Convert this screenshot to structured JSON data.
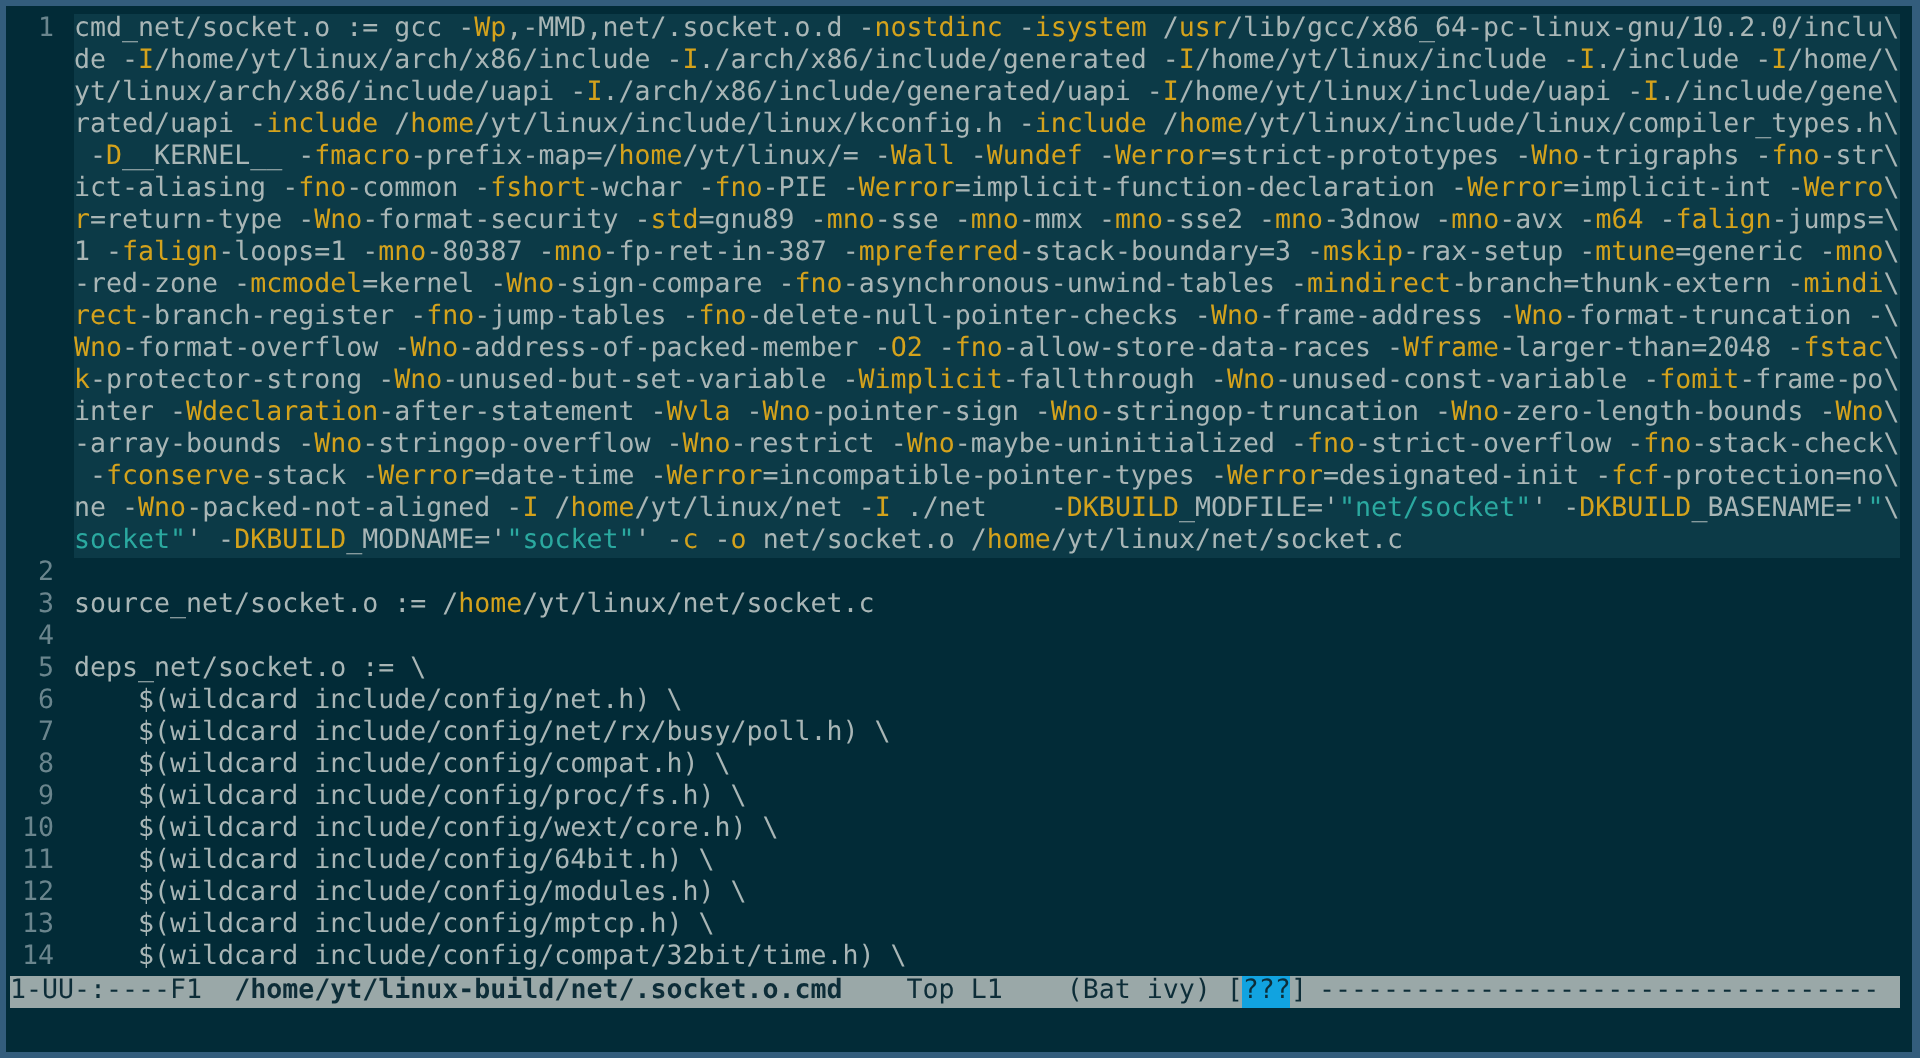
{
  "editor": {
    "lines": [
      {
        "number": "1",
        "highlighted": true,
        "wrapped": [
          {
            "spans": [
              {
                "kind": "plain",
                "text": "cmd_net/socket.o := gcc -"
              },
              {
                "kind": "option",
                "text": "Wp"
              },
              {
                "kind": "plain",
                "text": ",-MMD,net/.socket.o.d -"
              },
              {
                "kind": "option",
                "text": "nostdinc"
              },
              {
                "kind": "plain",
                "text": " -"
              },
              {
                "kind": "option",
                "text": "isystem"
              },
              {
                "kind": "plain",
                "text": " /"
              },
              {
                "kind": "option",
                "text": "usr"
              },
              {
                "kind": "plain",
                "text": "/lib/gcc/x86_64-pc-linux-gnu/10.2.0/inclu\\"
              }
            ]
          },
          {
            "spans": [
              {
                "kind": "plain",
                "text": "de -"
              },
              {
                "kind": "option",
                "text": "I"
              },
              {
                "kind": "plain",
                "text": "/home/yt/linux/arch/x86/include -"
              },
              {
                "kind": "option",
                "text": "I"
              },
              {
                "kind": "plain",
                "text": "./arch/x86/include/generated -"
              },
              {
                "kind": "option",
                "text": "I"
              },
              {
                "kind": "plain",
                "text": "/home/yt/linux/include -"
              },
              {
                "kind": "option",
                "text": "I"
              },
              {
                "kind": "plain",
                "text": "./include -"
              },
              {
                "kind": "option",
                "text": "I"
              },
              {
                "kind": "plain",
                "text": "/home/\\"
              }
            ]
          },
          {
            "spans": [
              {
                "kind": "plain",
                "text": "yt/linux/arch/x86/include/uapi -"
              },
              {
                "kind": "option",
                "text": "I"
              },
              {
                "kind": "plain",
                "text": "./arch/x86/include/generated/uapi -"
              },
              {
                "kind": "option",
                "text": "I"
              },
              {
                "kind": "plain",
                "text": "/home/yt/linux/include/uapi -"
              },
              {
                "kind": "option",
                "text": "I"
              },
              {
                "kind": "plain",
                "text": "./include/gene\\"
              }
            ]
          },
          {
            "spans": [
              {
                "kind": "plain",
                "text": "rated/uapi -"
              },
              {
                "kind": "option",
                "text": "include"
              },
              {
                "kind": "plain",
                "text": " /"
              },
              {
                "kind": "option",
                "text": "home"
              },
              {
                "kind": "plain",
                "text": "/yt/linux/include/linux/kconfig.h -"
              },
              {
                "kind": "option",
                "text": "include"
              },
              {
                "kind": "plain",
                "text": " /"
              },
              {
                "kind": "option",
                "text": "home"
              },
              {
                "kind": "plain",
                "text": "/yt/linux/include/linux/compiler_types.h\\"
              }
            ]
          },
          {
            "spans": [
              {
                "kind": "plain",
                "text": " -"
              },
              {
                "kind": "option",
                "text": "D"
              },
              {
                "kind": "plain",
                "text": "__KERNEL__ -"
              },
              {
                "kind": "option",
                "text": "fmacro"
              },
              {
                "kind": "plain",
                "text": "-prefix-map=/"
              },
              {
                "kind": "option",
                "text": "home"
              },
              {
                "kind": "plain",
                "text": "/yt/linux/= -"
              },
              {
                "kind": "option",
                "text": "Wall"
              },
              {
                "kind": "plain",
                "text": " -"
              },
              {
                "kind": "option",
                "text": "Wundef"
              },
              {
                "kind": "plain",
                "text": " -"
              },
              {
                "kind": "option",
                "text": "Werror"
              },
              {
                "kind": "plain",
                "text": "=strict-prototypes -"
              },
              {
                "kind": "option",
                "text": "Wno"
              },
              {
                "kind": "plain",
                "text": "-trigraphs -"
              },
              {
                "kind": "option",
                "text": "fno"
              },
              {
                "kind": "plain",
                "text": "-str\\"
              }
            ]
          },
          {
            "spans": [
              {
                "kind": "plain",
                "text": "ict-aliasing -"
              },
              {
                "kind": "option",
                "text": "fno"
              },
              {
                "kind": "plain",
                "text": "-common -"
              },
              {
                "kind": "option",
                "text": "fshort"
              },
              {
                "kind": "plain",
                "text": "-wchar -"
              },
              {
                "kind": "option",
                "text": "fno"
              },
              {
                "kind": "plain",
                "text": "-PIE -"
              },
              {
                "kind": "option",
                "text": "Werror"
              },
              {
                "kind": "plain",
                "text": "=implicit-function-declaration -"
              },
              {
                "kind": "option",
                "text": "Werror"
              },
              {
                "kind": "plain",
                "text": "=implicit-int -"
              },
              {
                "kind": "option",
                "text": "Werro"
              },
              {
                "kind": "plain",
                "text": "\\"
              }
            ]
          },
          {
            "spans": [
              {
                "kind": "option",
                "text": "r"
              },
              {
                "kind": "plain",
                "text": "=return-type -"
              },
              {
                "kind": "option",
                "text": "Wno"
              },
              {
                "kind": "plain",
                "text": "-format-security -"
              },
              {
                "kind": "option",
                "text": "std"
              },
              {
                "kind": "plain",
                "text": "=gnu89 -"
              },
              {
                "kind": "option",
                "text": "mno"
              },
              {
                "kind": "plain",
                "text": "-sse -"
              },
              {
                "kind": "option",
                "text": "mno"
              },
              {
                "kind": "plain",
                "text": "-mmx -"
              },
              {
                "kind": "option",
                "text": "mno"
              },
              {
                "kind": "plain",
                "text": "-sse2 -"
              },
              {
                "kind": "option",
                "text": "mno"
              },
              {
                "kind": "plain",
                "text": "-3dnow -"
              },
              {
                "kind": "option",
                "text": "mno"
              },
              {
                "kind": "plain",
                "text": "-avx -"
              },
              {
                "kind": "option",
                "text": "m64"
              },
              {
                "kind": "plain",
                "text": " -"
              },
              {
                "kind": "option",
                "text": "falign"
              },
              {
                "kind": "plain",
                "text": "-jumps=\\"
              }
            ]
          },
          {
            "spans": [
              {
                "kind": "plain",
                "text": "1 -"
              },
              {
                "kind": "option",
                "text": "falign"
              },
              {
                "kind": "plain",
                "text": "-loops=1 -"
              },
              {
                "kind": "option",
                "text": "mno"
              },
              {
                "kind": "plain",
                "text": "-80387 -"
              },
              {
                "kind": "option",
                "text": "mno"
              },
              {
                "kind": "plain",
                "text": "-fp-ret-in-387 -"
              },
              {
                "kind": "option",
                "text": "mpreferred"
              },
              {
                "kind": "plain",
                "text": "-stack-boundary=3 -"
              },
              {
                "kind": "option",
                "text": "mskip"
              },
              {
                "kind": "plain",
                "text": "-rax-setup -"
              },
              {
                "kind": "option",
                "text": "mtune"
              },
              {
                "kind": "plain",
                "text": "=generic -"
              },
              {
                "kind": "option",
                "text": "mno"
              },
              {
                "kind": "plain",
                "text": "\\"
              }
            ]
          },
          {
            "spans": [
              {
                "kind": "plain",
                "text": "-red-zone -"
              },
              {
                "kind": "option",
                "text": "mcmodel"
              },
              {
                "kind": "plain",
                "text": "=kernel -"
              },
              {
                "kind": "option",
                "text": "Wno"
              },
              {
                "kind": "plain",
                "text": "-sign-compare -"
              },
              {
                "kind": "option",
                "text": "fno"
              },
              {
                "kind": "plain",
                "text": "-asynchronous-unwind-tables -"
              },
              {
                "kind": "option",
                "text": "mindirect"
              },
              {
                "kind": "plain",
                "text": "-branch=thunk-extern -"
              },
              {
                "kind": "option",
                "text": "mindi"
              },
              {
                "kind": "plain",
                "text": "\\"
              }
            ]
          },
          {
            "spans": [
              {
                "kind": "option",
                "text": "rect"
              },
              {
                "kind": "plain",
                "text": "-branch-register -"
              },
              {
                "kind": "option",
                "text": "fno"
              },
              {
                "kind": "plain",
                "text": "-jump-tables -"
              },
              {
                "kind": "option",
                "text": "fno"
              },
              {
                "kind": "plain",
                "text": "-delete-null-pointer-checks -"
              },
              {
                "kind": "option",
                "text": "Wno"
              },
              {
                "kind": "plain",
                "text": "-frame-address -"
              },
              {
                "kind": "option",
                "text": "Wno"
              },
              {
                "kind": "plain",
                "text": "-format-truncation -\\"
              }
            ]
          },
          {
            "spans": [
              {
                "kind": "option",
                "text": "Wno"
              },
              {
                "kind": "plain",
                "text": "-format-overflow -"
              },
              {
                "kind": "option",
                "text": "Wno"
              },
              {
                "kind": "plain",
                "text": "-address-of-packed-member -"
              },
              {
                "kind": "option",
                "text": "O2"
              },
              {
                "kind": "plain",
                "text": " -"
              },
              {
                "kind": "option",
                "text": "fno"
              },
              {
                "kind": "plain",
                "text": "-allow-store-data-races -"
              },
              {
                "kind": "option",
                "text": "Wframe"
              },
              {
                "kind": "plain",
                "text": "-larger-than=2048 -"
              },
              {
                "kind": "option",
                "text": "fstac"
              },
              {
                "kind": "plain",
                "text": "\\"
              }
            ]
          },
          {
            "spans": [
              {
                "kind": "option",
                "text": "k"
              },
              {
                "kind": "plain",
                "text": "-protector-strong -"
              },
              {
                "kind": "option",
                "text": "Wno"
              },
              {
                "kind": "plain",
                "text": "-unused-but-set-variable -"
              },
              {
                "kind": "option",
                "text": "Wimplicit"
              },
              {
                "kind": "plain",
                "text": "-fallthrough -"
              },
              {
                "kind": "option",
                "text": "Wno"
              },
              {
                "kind": "plain",
                "text": "-unused-const-variable -"
              },
              {
                "kind": "option",
                "text": "fomit"
              },
              {
                "kind": "plain",
                "text": "-frame-po\\"
              }
            ]
          },
          {
            "spans": [
              {
                "kind": "plain",
                "text": "inter -"
              },
              {
                "kind": "option",
                "text": "Wdeclaration"
              },
              {
                "kind": "plain",
                "text": "-after-statement -"
              },
              {
                "kind": "option",
                "text": "Wvla"
              },
              {
                "kind": "plain",
                "text": " -"
              },
              {
                "kind": "option",
                "text": "Wno"
              },
              {
                "kind": "plain",
                "text": "-pointer-sign -"
              },
              {
                "kind": "option",
                "text": "Wno"
              },
              {
                "kind": "plain",
                "text": "-stringop-truncation -"
              },
              {
                "kind": "option",
                "text": "Wno"
              },
              {
                "kind": "plain",
                "text": "-zero-length-bounds -"
              },
              {
                "kind": "option",
                "text": "Wno"
              },
              {
                "kind": "plain",
                "text": "\\"
              }
            ]
          },
          {
            "spans": [
              {
                "kind": "plain",
                "text": "-array-bounds -"
              },
              {
                "kind": "option",
                "text": "Wno"
              },
              {
                "kind": "plain",
                "text": "-stringop-overflow -"
              },
              {
                "kind": "option",
                "text": "Wno"
              },
              {
                "kind": "plain",
                "text": "-restrict -"
              },
              {
                "kind": "option",
                "text": "Wno"
              },
              {
                "kind": "plain",
                "text": "-maybe-uninitialized -"
              },
              {
                "kind": "option",
                "text": "fno"
              },
              {
                "kind": "plain",
                "text": "-strict-overflow -"
              },
              {
                "kind": "option",
                "text": "fno"
              },
              {
                "kind": "plain",
                "text": "-stack-check\\"
              }
            ]
          },
          {
            "spans": [
              {
                "kind": "plain",
                "text": " -"
              },
              {
                "kind": "option",
                "text": "fconserve"
              },
              {
                "kind": "plain",
                "text": "-stack -"
              },
              {
                "kind": "option",
                "text": "Werror"
              },
              {
                "kind": "plain",
                "text": "=date-time -"
              },
              {
                "kind": "option",
                "text": "Werror"
              },
              {
                "kind": "plain",
                "text": "=incompatible-pointer-types -"
              },
              {
                "kind": "option",
                "text": "Werror"
              },
              {
                "kind": "plain",
                "text": "=designated-init -"
              },
              {
                "kind": "option",
                "text": "fcf"
              },
              {
                "kind": "plain",
                "text": "-protection=no\\"
              }
            ]
          },
          {
            "spans": [
              {
                "kind": "plain",
                "text": "ne -"
              },
              {
                "kind": "option",
                "text": "Wno"
              },
              {
                "kind": "plain",
                "text": "-packed-not-aligned -"
              },
              {
                "kind": "option",
                "text": "I"
              },
              {
                "kind": "plain",
                "text": " /"
              },
              {
                "kind": "option",
                "text": "home"
              },
              {
                "kind": "plain",
                "text": "/yt/linux/net -"
              },
              {
                "kind": "option",
                "text": "I"
              },
              {
                "kind": "plain",
                "text": " ./net    -"
              },
              {
                "kind": "option",
                "text": "DKBUILD"
              },
              {
                "kind": "plain",
                "text": "_MODFILE='"
              },
              {
                "kind": "string",
                "text": "\"net/socket\""
              },
              {
                "kind": "plain",
                "text": "' -"
              },
              {
                "kind": "option",
                "text": "DKBUILD"
              },
              {
                "kind": "plain",
                "text": "_BASENAME='"
              },
              {
                "kind": "string",
                "text": "\""
              },
              {
                "kind": "plain",
                "text": "\\"
              }
            ]
          },
          {
            "spans": [
              {
                "kind": "string",
                "text": "socket\""
              },
              {
                "kind": "plain",
                "text": "' -"
              },
              {
                "kind": "option",
                "text": "DKBUILD"
              },
              {
                "kind": "plain",
                "text": "_MODNAME='"
              },
              {
                "kind": "string",
                "text": "\"socket\""
              },
              {
                "kind": "plain",
                "text": "' -"
              },
              {
                "kind": "option",
                "text": "c"
              },
              {
                "kind": "plain",
                "text": " -"
              },
              {
                "kind": "option",
                "text": "o"
              },
              {
                "kind": "plain",
                "text": " net/socket.o /"
              },
              {
                "kind": "option",
                "text": "home"
              },
              {
                "kind": "plain",
                "text": "/yt/linux/net/socket.c"
              }
            ]
          }
        ]
      },
      {
        "number": "2",
        "highlighted": false
      },
      {
        "number": "3",
        "highlighted": false,
        "wrapped": [
          {
            "spans": [
              {
                "kind": "plain",
                "text": "source_net/socket.o := /"
              },
              {
                "kind": "option",
                "text": "home"
              },
              {
                "kind": "plain",
                "text": "/yt/linux/net/socket.c"
              }
            ]
          }
        ]
      },
      {
        "number": "4",
        "highlighted": false
      },
      {
        "number": "5",
        "highlighted": false,
        "wrapped": [
          {
            "spans": [
              {
                "kind": "plain",
                "text": "deps_net/socket.o := \\"
              }
            ]
          }
        ]
      },
      {
        "number": "6",
        "highlighted": false,
        "wrapped": [
          {
            "spans": [
              {
                "kind": "plain",
                "text": "    $(wildcard include/config/net.h) \\"
              }
            ]
          }
        ]
      },
      {
        "number": "7",
        "highlighted": false,
        "wrapped": [
          {
            "spans": [
              {
                "kind": "plain",
                "text": "    $(wildcard include/config/net/rx/busy/poll.h) \\"
              }
            ]
          }
        ]
      },
      {
        "number": "8",
        "highlighted": false,
        "wrapped": [
          {
            "spans": [
              {
                "kind": "plain",
                "text": "    $(wildcard include/config/compat.h) \\"
              }
            ]
          }
        ]
      },
      {
        "number": "9",
        "highlighted": false,
        "wrapped": [
          {
            "spans": [
              {
                "kind": "plain",
                "text": "    $(wildcard include/config/proc/fs.h) \\"
              }
            ]
          }
        ]
      },
      {
        "number": "10",
        "highlighted": false,
        "wrapped": [
          {
            "spans": [
              {
                "kind": "plain",
                "text": "    $(wildcard include/config/wext/core.h) \\"
              }
            ]
          }
        ]
      },
      {
        "number": "11",
        "highlighted": false,
        "wrapped": [
          {
            "spans": [
              {
                "kind": "plain",
                "text": "    $(wildcard include/config/64bit.h) \\"
              }
            ]
          }
        ]
      },
      {
        "number": "12",
        "highlighted": false,
        "wrapped": [
          {
            "spans": [
              {
                "kind": "plain",
                "text": "    $(wildcard include/config/modules.h) \\"
              }
            ]
          }
        ]
      },
      {
        "number": "13",
        "highlighted": false,
        "wrapped": [
          {
            "spans": [
              {
                "kind": "plain",
                "text": "    $(wildcard include/config/mptcp.h) \\"
              }
            ]
          }
        ]
      },
      {
        "number": "14",
        "highlighted": false,
        "wrapped": [
          {
            "spans": [
              {
                "kind": "plain",
                "text": "    $(wildcard include/config/compat/32bit/time.h) \\"
              }
            ]
          }
        ]
      }
    ]
  },
  "mode_line": {
    "status": "1-UU-:----F1",
    "buffer": "/home/yt/linux-build/net/.socket.o.cmd",
    "position": "Top L1",
    "modes": "(Bat ivy)",
    "bracket_open": "[",
    "tag": "???",
    "bracket_close": "]",
    "fill": "-----------------------------------"
  }
}
